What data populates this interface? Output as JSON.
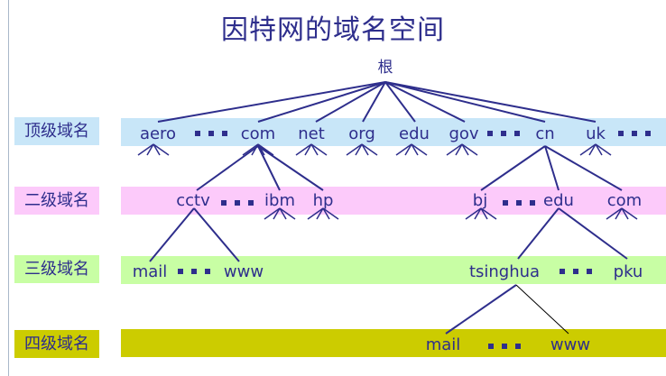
{
  "title": "因特网的域名空间",
  "levels": {
    "top": "顶级域名",
    "second": "二级域名",
    "third": "三级域名",
    "fourth": "四级域名"
  },
  "colors": {
    "ink": "#2e2e8c",
    "top_band": "#c8e6f8",
    "second_band": "#fccafa",
    "third_band": "#c8fea4",
    "fourth_band": "#cccc00"
  },
  "tree": {
    "root": "根",
    "top": {
      "aero": "aero",
      "com": "com",
      "net": "net",
      "org": "org",
      "edu": "edu",
      "gov": "gov",
      "cn": "cn",
      "uk": "uk"
    },
    "second": {
      "cctv": "cctv",
      "ibm": "ibm",
      "hp": "hp",
      "bj": "bj",
      "edu": "edu",
      "com": "com"
    },
    "third": {
      "mail": "mail",
      "www": "www",
      "tsinghua": "tsinghua",
      "pku": "pku"
    },
    "fourth": {
      "mail": "mail",
      "www": "www"
    }
  }
}
